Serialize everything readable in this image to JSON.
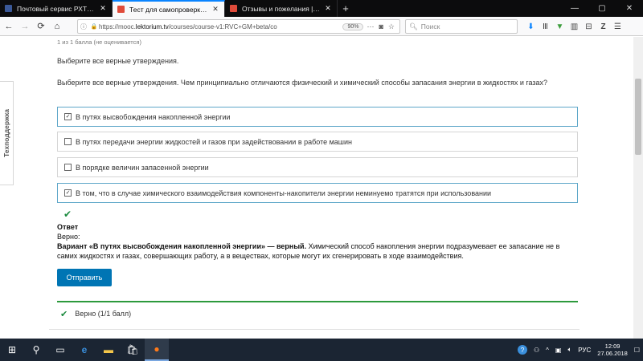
{
  "browser": {
    "tabs": [
      {
        "title": "Почтовый сервис РХТУ им. Д.И",
        "favicon_color": "#3b5998",
        "active": false
      },
      {
        "title": "Тест для самопроверки | 2.3",
        "favicon_color": "#e04b3a",
        "active": true
      },
      {
        "title": "Отзывы и пожелания | Лекторий",
        "favicon_color": "#e04b3a",
        "active": false
      }
    ],
    "url_prefix": "https://mooc.",
    "url_domain": "lektorium.tv",
    "url_rest": "/courses/course-v1:RVC+GM+beta/co",
    "zoom": "90%",
    "search_placeholder": "Поиск",
    "window_controls": [
      "—",
      "▢",
      "✕"
    ]
  },
  "sidebar": {
    "support_label": "Техподдержка"
  },
  "problem": {
    "score_text": "1 из 1 балла (не оценивается)",
    "instruction": "Выберите все верные утверждения.",
    "question": "Выберите все верные утверждения. Чем принципиально отличаются физический и химический способы запасания энергии в жидкостях и газах?",
    "options": [
      {
        "label": "В путях высвобождения накопленной энергии",
        "checked": true
      },
      {
        "label": "В путях передачи энергии жидкостей и газов при задействовании в работе машин",
        "checked": false
      },
      {
        "label": "В порядке величин запасенной энергии",
        "checked": false
      },
      {
        "label": "В том, что в случае химического взаимодействия компоненты-накопители энергии неминуемо тратятся при использовании",
        "checked": true
      }
    ],
    "answer_title": "Ответ",
    "answer_verdict": "Верно:",
    "answer_bold": "Вариант «В путях высвобождения накопленной энергии» — верный.",
    "answer_text": " Химический способ накопления энергии подразумевает ее запасание не в самих жидкостях и газах, совершающих работу, а в веществах, которые могут их сгенерировать в ходе взаимодействия.",
    "submit_label": "Отправить",
    "result_text": "Верно (1/1 балл)"
  },
  "taskbar": {
    "language": "РУС",
    "time": "12:09",
    "date": "27.06.2018"
  }
}
